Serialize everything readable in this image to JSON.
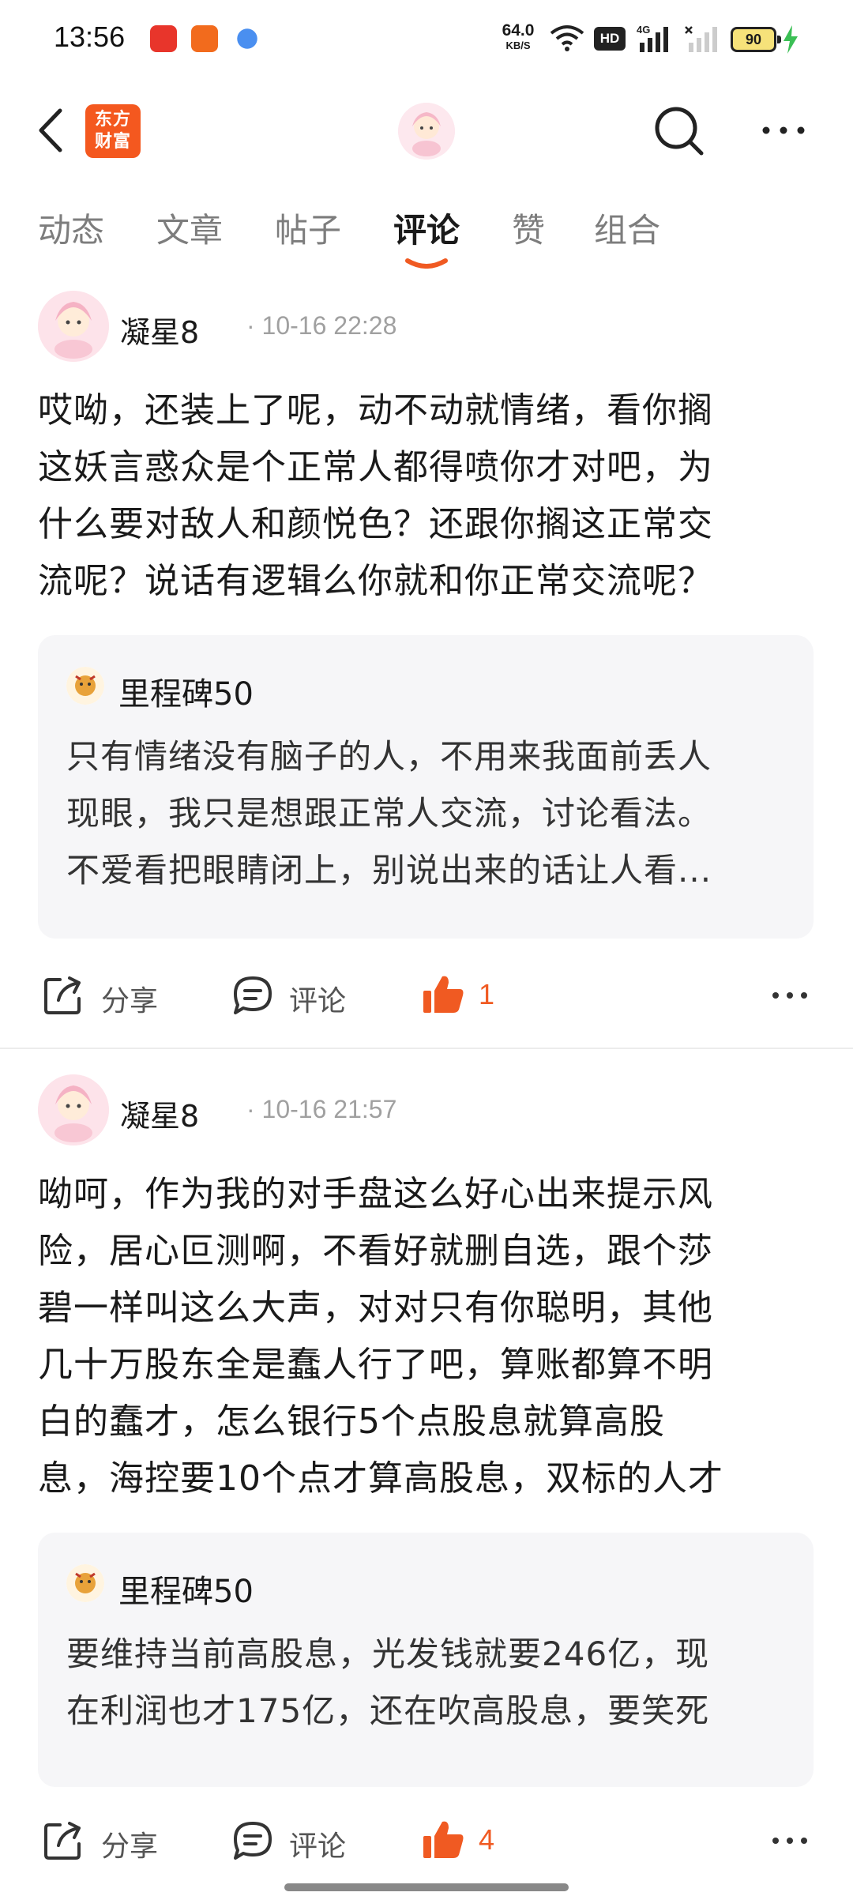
{
  "status_bar": {
    "time": "13:56",
    "net_speed_value": "64.0",
    "net_speed_unit": "KB/S",
    "hd_label": "HD",
    "signal_label": "4G",
    "battery": "90"
  },
  "header": {
    "logo_line1": "东方",
    "logo_line2": "财富",
    "brand_color": "#f4581f"
  },
  "tabs": [
    {
      "label": "动态"
    },
    {
      "label": "文章"
    },
    {
      "label": "帖子"
    },
    {
      "label": "评论",
      "active": true
    },
    {
      "label": "赞"
    },
    {
      "label": "组合"
    }
  ],
  "comments": [
    {
      "author": "凝星8",
      "time": "· 10-16 22:28",
      "text_lines": [
        "哎呦，还装上了呢，动不动就情绪，看你搁",
        "这妖言惑众是个正常人都得喷你才对吧，为",
        "什么要对敌人和颜悦色？还跟你搁这正常交",
        "流呢？说话有逻辑么你就和你正常交流呢？"
      ],
      "quote": {
        "author": "里程碑50",
        "lines": [
          "只有情绪没有脑子的人，不用来我面前丢人",
          "现眼，我只是想跟正常人交流，讨论看法。",
          "不爱看把眼睛闭上，别说出来的话让人看..."
        ]
      },
      "share_label": "分享",
      "comment_label": "评论",
      "likes": "1"
    },
    {
      "author": "凝星8",
      "time": "· 10-16 21:57",
      "text_lines": [
        "呦呵，作为我的对手盘这么好心出来提示风",
        "险，居心叵测啊，不看好就删自选，跟个莎",
        "碧一样叫这么大声，对对只有你聪明，其他",
        "几十万股东全是蠢人行了吧，算账都算不明",
        "白的蠢才，怎么银行5个点股息就算高股",
        "息，海控要10个点才算高股息，双标的人才"
      ],
      "quote": {
        "author": "里程碑50",
        "lines": [
          "要维持当前高股息，光发钱就要246亿，现",
          "在利润也才175亿，还在吹高股息，要笑死"
        ]
      },
      "share_label": "分享",
      "comment_label": "评论",
      "likes": "4"
    }
  ],
  "colors": {
    "accent": "#f05a22",
    "text": "#1a1a1a",
    "muted": "#a0a0a0",
    "quote_bg": "#f6f6f8"
  }
}
